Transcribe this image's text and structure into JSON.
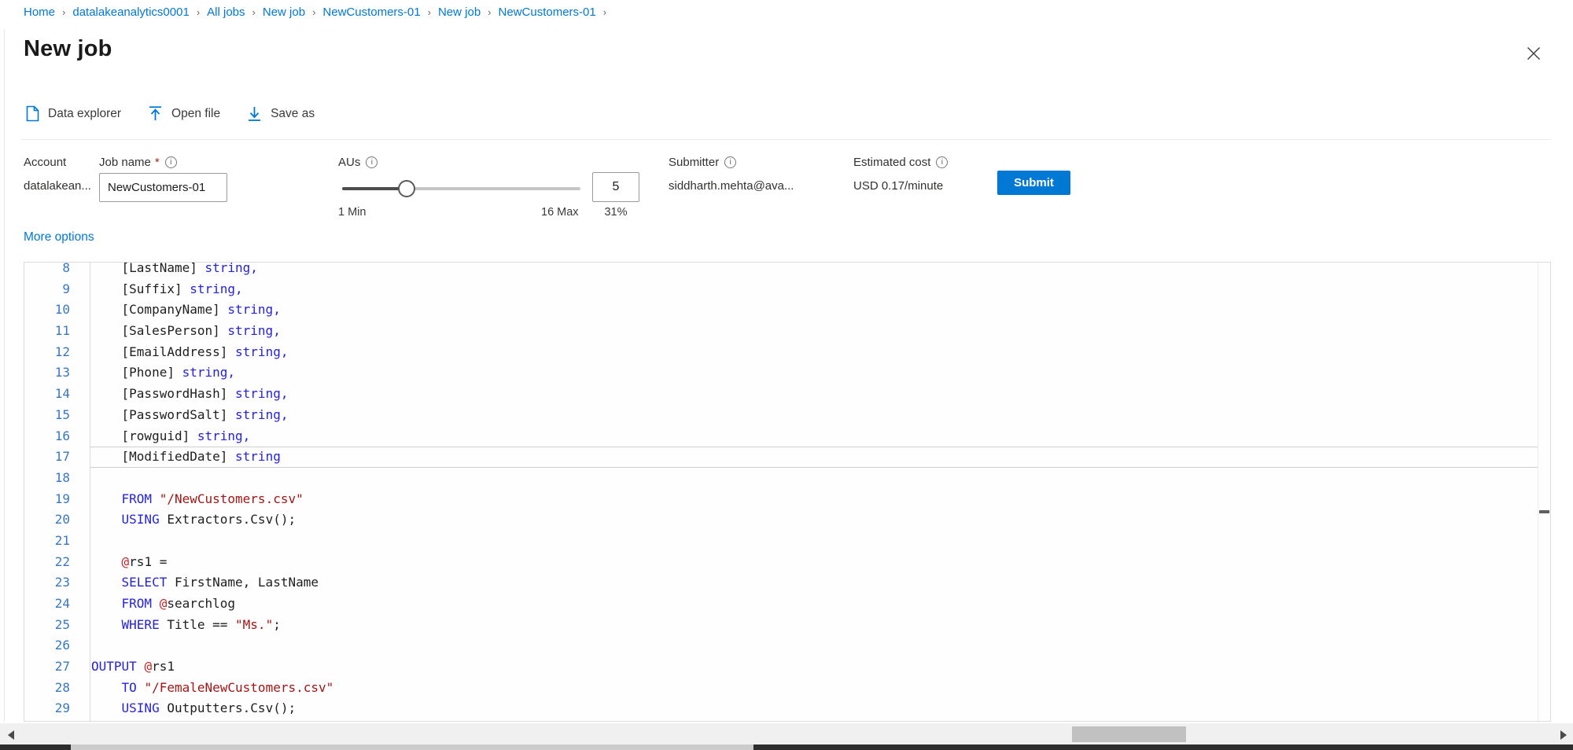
{
  "colors": {
    "accent": "#0078d4",
    "kw": "#2323dd",
    "str": "#a31515",
    "at": "#c22222",
    "lnum": "#3778c2",
    "code-text": "#1e1e1e"
  },
  "breadcrumb": {
    "separator": "›",
    "items": [
      "Home",
      "datalakeanalytics0001",
      "All jobs",
      "New job",
      "NewCustomers-01",
      "New job",
      "NewCustomers-01"
    ]
  },
  "header": {
    "title": "New job"
  },
  "toolbar": {
    "items": [
      {
        "icon": "document-icon",
        "label": "Data explorer"
      },
      {
        "icon": "upload-arrow-icon",
        "label": "Open file"
      },
      {
        "icon": "download-arrow-icon",
        "label": "Save as"
      }
    ]
  },
  "form": {
    "account": {
      "label": "Account",
      "value": "datalakean..."
    },
    "job_name": {
      "label": "Job name",
      "required_mark": "*",
      "value": "NewCustomers-01"
    },
    "aus": {
      "label": "AUs",
      "min_label": "1 Min",
      "max_label": "16 Max",
      "value": "5",
      "percent": "31%",
      "fill_percent": 27
    },
    "submitter": {
      "label": "Submitter",
      "value": "siddharth.mehta@ava..."
    },
    "estimated_cost": {
      "label": "Estimated cost",
      "value": "USD 0.17/minute"
    },
    "submit_label": "Submit",
    "more_options_label": "More options"
  },
  "icons": {
    "info_glyph": "i"
  },
  "editor": {
    "current_line": "17",
    "lines": [
      {
        "num": "8",
        "tokens": [
          {
            "c": "d",
            "t": "    [LastName] "
          },
          {
            "c": "k",
            "t": "string,"
          }
        ]
      },
      {
        "num": "9",
        "tokens": [
          {
            "c": "d",
            "t": "    [Suffix] "
          },
          {
            "c": "k",
            "t": "string,"
          }
        ]
      },
      {
        "num": "10",
        "tokens": [
          {
            "c": "d",
            "t": "    [CompanyName] "
          },
          {
            "c": "k",
            "t": "string,"
          }
        ]
      },
      {
        "num": "11",
        "tokens": [
          {
            "c": "d",
            "t": "    [SalesPerson] "
          },
          {
            "c": "k",
            "t": "string,"
          }
        ]
      },
      {
        "num": "12",
        "tokens": [
          {
            "c": "d",
            "t": "    [EmailAddress] "
          },
          {
            "c": "k",
            "t": "string,"
          }
        ]
      },
      {
        "num": "13",
        "tokens": [
          {
            "c": "d",
            "t": "    [Phone] "
          },
          {
            "c": "k",
            "t": "string,"
          }
        ]
      },
      {
        "num": "14",
        "tokens": [
          {
            "c": "d",
            "t": "    [PasswordHash] "
          },
          {
            "c": "k",
            "t": "string,"
          }
        ]
      },
      {
        "num": "15",
        "tokens": [
          {
            "c": "d",
            "t": "    [PasswordSalt] "
          },
          {
            "c": "k",
            "t": "string,"
          }
        ]
      },
      {
        "num": "16",
        "tokens": [
          {
            "c": "d",
            "t": "    [rowguid] "
          },
          {
            "c": "k",
            "t": "string,"
          }
        ]
      },
      {
        "num": "17",
        "tokens": [
          {
            "c": "d",
            "t": "    [ModifiedDate] "
          },
          {
            "c": "k",
            "t": "string"
          }
        ]
      },
      {
        "num": "18",
        "tokens": []
      },
      {
        "num": "19",
        "tokens": [
          {
            "c": "d",
            "t": "    "
          },
          {
            "c": "k",
            "t": "FROM"
          },
          {
            "c": "d",
            "t": " "
          },
          {
            "c": "s",
            "t": "\"/NewCustomers.csv\""
          }
        ]
      },
      {
        "num": "20",
        "tokens": [
          {
            "c": "d",
            "t": "    "
          },
          {
            "c": "k",
            "t": "USING"
          },
          {
            "c": "d",
            "t": " Extractors.Csv();"
          }
        ]
      },
      {
        "num": "21",
        "tokens": []
      },
      {
        "num": "22",
        "tokens": [
          {
            "c": "d",
            "t": "    "
          },
          {
            "c": "a",
            "t": "@"
          },
          {
            "c": "d",
            "t": "rs1 ="
          }
        ]
      },
      {
        "num": "23",
        "tokens": [
          {
            "c": "d",
            "t": "    "
          },
          {
            "c": "k",
            "t": "SELECT"
          },
          {
            "c": "d",
            "t": " FirstName, LastName"
          }
        ]
      },
      {
        "num": "24",
        "tokens": [
          {
            "c": "d",
            "t": "    "
          },
          {
            "c": "k",
            "t": "FROM"
          },
          {
            "c": "d",
            "t": " "
          },
          {
            "c": "a",
            "t": "@"
          },
          {
            "c": "d",
            "t": "searchlog"
          }
        ]
      },
      {
        "num": "25",
        "tokens": [
          {
            "c": "d",
            "t": "    "
          },
          {
            "c": "k",
            "t": "WHERE"
          },
          {
            "c": "d",
            "t": " Title == "
          },
          {
            "c": "s",
            "t": "\"Ms.\""
          },
          {
            "c": "d",
            "t": ";"
          }
        ]
      },
      {
        "num": "26",
        "tokens": []
      },
      {
        "num": "27",
        "tokens": [
          {
            "c": "k",
            "t": "OUTPUT"
          },
          {
            "c": "d",
            "t": " "
          },
          {
            "c": "a",
            "t": "@"
          },
          {
            "c": "d",
            "t": "rs1"
          }
        ]
      },
      {
        "num": "28",
        "tokens": [
          {
            "c": "d",
            "t": "    "
          },
          {
            "c": "k",
            "t": "TO"
          },
          {
            "c": "d",
            "t": " "
          },
          {
            "c": "s",
            "t": "\"/FemaleNewCustomers.csv\""
          }
        ]
      },
      {
        "num": "29",
        "tokens": [
          {
            "c": "d",
            "t": "    "
          },
          {
            "c": "k",
            "t": "USING"
          },
          {
            "c": "d",
            "t": " Outputters.Csv();"
          }
        ]
      }
    ]
  }
}
